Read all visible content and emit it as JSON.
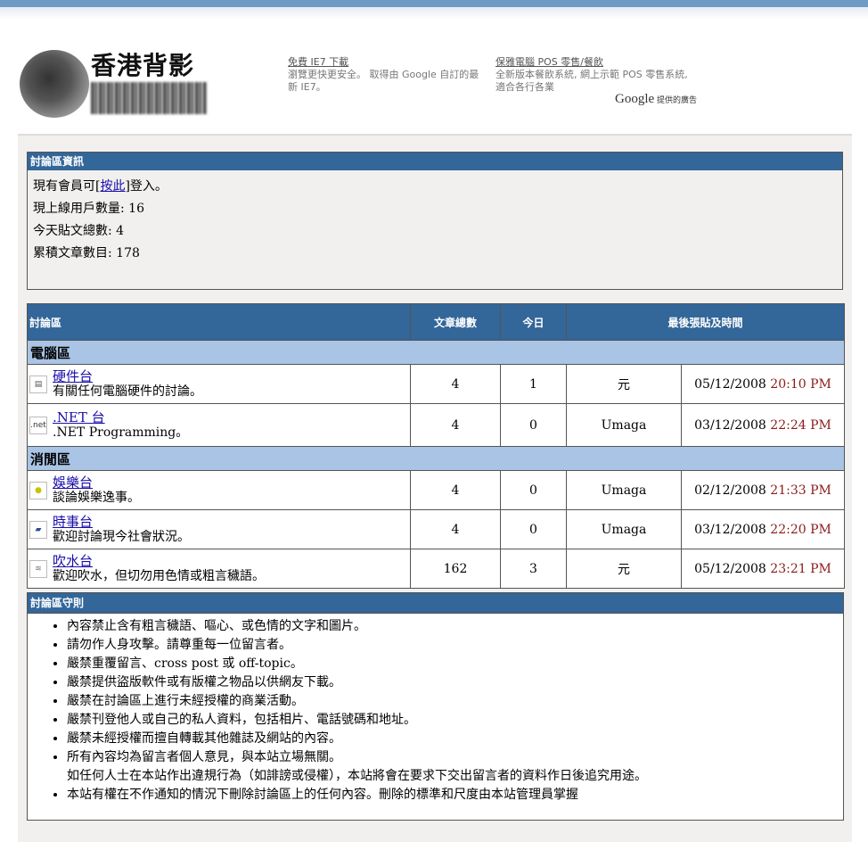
{
  "header": {
    "logo_title": "香港背影"
  },
  "ads": [
    {
      "title": "免費 IE7 下載",
      "lines": [
        "瀏覽更快更安全。 取得由 Google 自訂的最",
        "新 IE7。"
      ]
    },
    {
      "title": "保雅電腦 POS 零售/餐飲",
      "lines": [
        "全新版本餐飲系統, 網上示範 POS 零售系統,",
        "適合各行各業"
      ]
    }
  ],
  "google_tag": {
    "brand": "Google",
    "text": "提供的廣告"
  },
  "info": {
    "header": "討論區資訊",
    "login_pre": "現有會員可[",
    "login_link": "按此",
    "login_post": "]登入。",
    "online_users": "現上線用戶數量: 16",
    "today_posts": "今天貼文總數: 4",
    "total_posts": "累積文章數目: 178"
  },
  "forum_table": {
    "headers": {
      "forum": "討論區",
      "posts": "文章總數",
      "today": "今日",
      "last_post": "最後張貼及時間"
    },
    "categories": [
      {
        "name": "電腦區",
        "forums": [
          {
            "icon": "hardware-icon",
            "name": "硬件台",
            "desc": "有關任何電腦硬件的討論。",
            "posts": "4",
            "today": "1",
            "user": "元",
            "date": "05/12/2008",
            "time": "20:10 PM"
          },
          {
            "icon": "dotnet-icon",
            "name": ".NET 台",
            "desc": ".NET Programming。",
            "posts": "4",
            "today": "0",
            "user": "Umaga",
            "date": "03/12/2008",
            "time": "22:24 PM"
          }
        ]
      },
      {
        "name": "消閒區",
        "forums": [
          {
            "icon": "entertainment-icon",
            "name": "娛樂台",
            "desc": "談論娛樂逸事。",
            "posts": "4",
            "today": "0",
            "user": "Umaga",
            "date": "02/12/2008",
            "time": "21:33 PM"
          },
          {
            "icon": "news-icon",
            "name": "時事台",
            "desc": "歡迎討論現今社會狀況。",
            "posts": "4",
            "today": "0",
            "user": "Umaga",
            "date": "03/12/2008",
            "time": "22:20 PM"
          },
          {
            "icon": "chat-icon",
            "name": "吹水台",
            "desc": "歡迎吹水，但切勿用色情或粗言穢語。",
            "posts": "162",
            "today": "3",
            "user": "元",
            "date": "05/12/2008",
            "time": "23:21 PM"
          }
        ]
      }
    ]
  },
  "rules": {
    "header": "討論區守則",
    "items": [
      "內容禁止含有粗言穢語、嘔心、或色情的文字和圖片。",
      "請勿作人身攻擊。請尊重每一位留言者。",
      "嚴禁重覆留言、cross post 或 off-topic。",
      "嚴禁提供盜版軟件或有版權之物品以供網友下載。",
      "嚴禁在討論區上進行未經授權的商業活動。",
      "嚴禁刊登他人或自己的私人資料，包括相片、電話號碼和地址。",
      "嚴禁未經授權而擅自轉載其他雜誌及網站的內容。",
      "所有內容均為留言者個人意見，與本站立場無關。",
      "本站有權在不作通知的情況下刪除討論區上的任何內容。刪除的標準和尺度由本站管理員掌握"
    ],
    "item8_line2": "如任何人士在本站作出違規行為（如誹謗或侵權），本站將會在要求下交出留言者的資料作日後追究用途。"
  },
  "colors": {
    "header_bg": "#336699",
    "category_bg": "#a9c4e4",
    "time_text": "#8b1a1a",
    "link": "#1a0dab"
  }
}
